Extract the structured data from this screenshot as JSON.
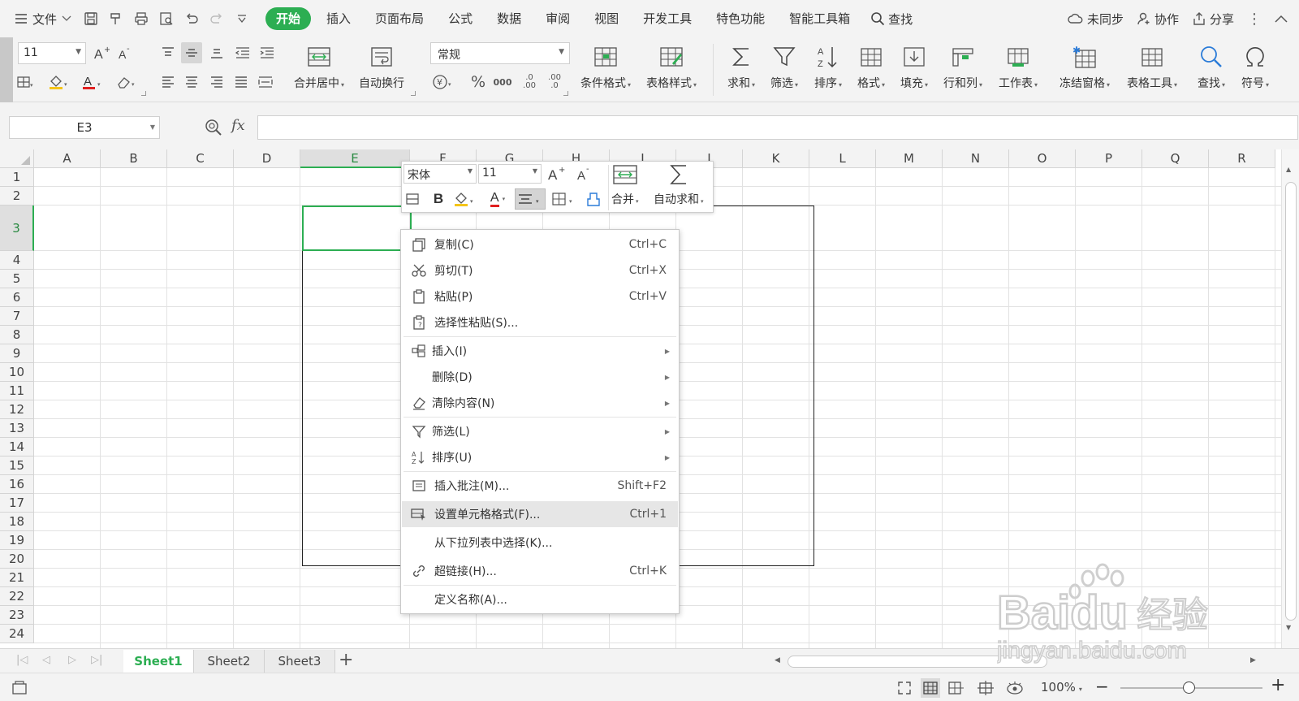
{
  "menubar": {
    "file_label": "文件",
    "tabs": [
      "开始",
      "插入",
      "页面布局",
      "公式",
      "数据",
      "审阅",
      "视图",
      "开发工具",
      "特色功能",
      "智能工具箱"
    ],
    "search_label": "查找",
    "sync_label": "未同步",
    "collab_label": "协作",
    "share_label": "分享"
  },
  "ribbon": {
    "font_size": "11",
    "number_format": "常规",
    "merge_label": "合并居中",
    "wrap_label": "自动换行",
    "cond_format_label": "条件格式",
    "table_style_label": "表格样式",
    "sum_label": "求和",
    "filter_label": "筛选",
    "sort_label": "排序",
    "format_label": "格式",
    "fill_label": "填充",
    "rowcol_label": "行和列",
    "worksheet_label": "工作表",
    "freeze_label": "冻结窗格",
    "table_tools_label": "表格工具",
    "find_label": "查找",
    "symbol_label": "符号"
  },
  "formula_bar": {
    "cell_ref": "E3",
    "fx_label": "fx",
    "formula": ""
  },
  "grid": {
    "columns": [
      "A",
      "B",
      "C",
      "D",
      "E",
      "F",
      "G",
      "H",
      "I",
      "J",
      "K",
      "L",
      "M",
      "N",
      "O",
      "P",
      "Q",
      "R"
    ],
    "rows": [
      "1",
      "2",
      "3",
      "4",
      "5",
      "6",
      "7",
      "8",
      "9",
      "10",
      "11",
      "12",
      "13",
      "14",
      "15",
      "16",
      "17",
      "18",
      "19",
      "20",
      "21",
      "22",
      "23",
      "24"
    ],
    "active_column": "E",
    "active_row": "3"
  },
  "mini_toolbar": {
    "font_name": "宋体",
    "font_size": "11",
    "bold_label": "B",
    "font_color_label": "A",
    "merge_label": "合并",
    "autosum_label": "自动求和"
  },
  "context_menu": {
    "items": [
      {
        "label": "复制(C)",
        "shortcut": "Ctrl+C"
      },
      {
        "label": "剪切(T)",
        "shortcut": "Ctrl+X"
      },
      {
        "label": "粘贴(P)",
        "shortcut": "Ctrl+V"
      },
      {
        "label": "选择性粘贴(S)...",
        "shortcut": ""
      },
      {
        "label": "插入(I)",
        "shortcut": ""
      },
      {
        "label": "删除(D)",
        "shortcut": ""
      },
      {
        "label": "清除内容(N)",
        "shortcut": ""
      },
      {
        "label": "筛选(L)",
        "shortcut": ""
      },
      {
        "label": "排序(U)",
        "shortcut": ""
      },
      {
        "label": "插入批注(M)...",
        "shortcut": "Shift+F2"
      },
      {
        "label": "设置单元格格式(F)...",
        "shortcut": "Ctrl+1"
      },
      {
        "label": "从下拉列表中选择(K)...",
        "shortcut": ""
      },
      {
        "label": "超链接(H)...",
        "shortcut": "Ctrl+K"
      },
      {
        "label": "定义名称(A)...",
        "shortcut": ""
      }
    ]
  },
  "sheet_tabs": {
    "tabs": [
      "Sheet1",
      "Sheet2",
      "Sheet3"
    ],
    "active": "Sheet1",
    "add_label": "+"
  },
  "status_bar": {
    "zoom": "100%"
  },
  "watermark": {
    "brand": "Baidu经验",
    "url": "jingyan.baidu.com"
  },
  "colors": {
    "accent": "#2cae52",
    "font_color_red": "#e02020",
    "fill_yellow": "#f5c518"
  }
}
